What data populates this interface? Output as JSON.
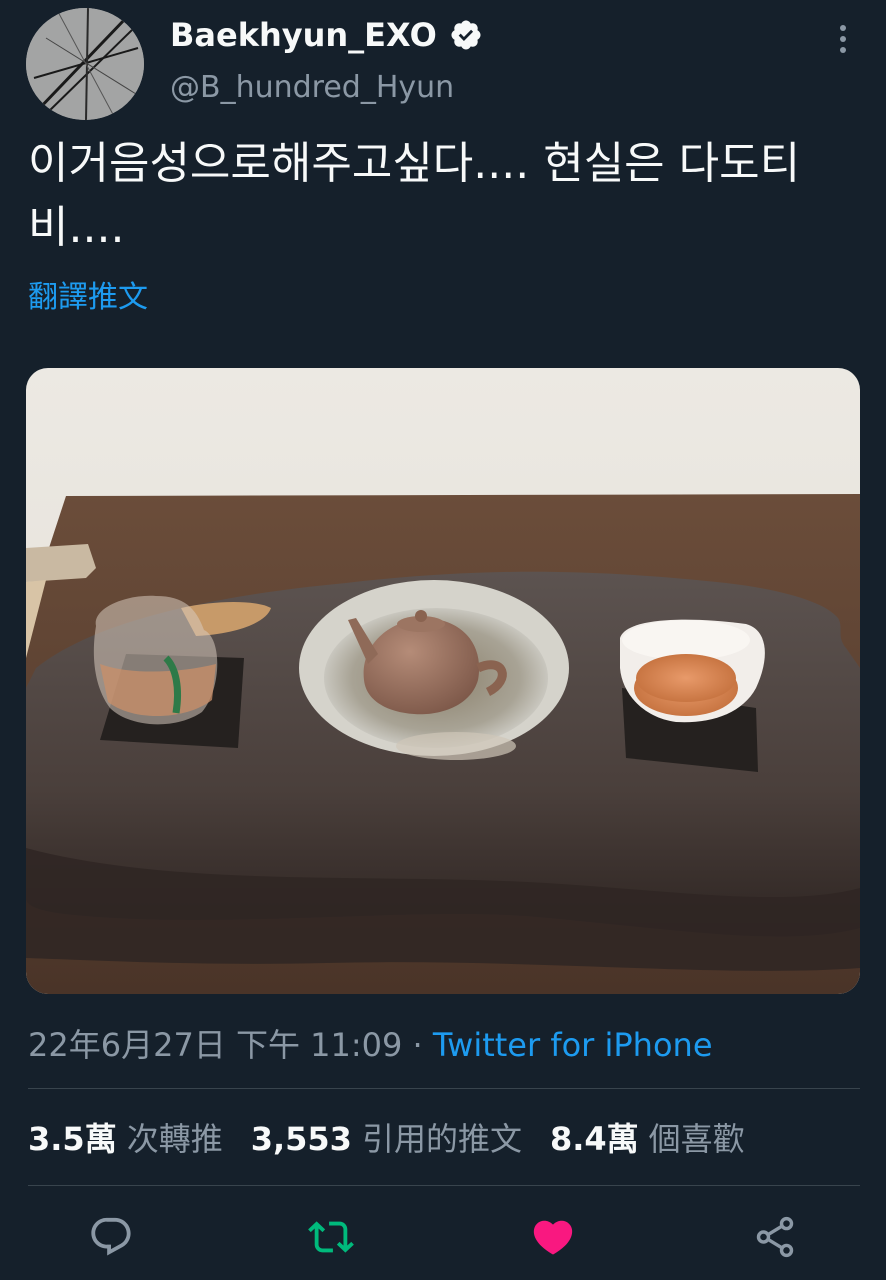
{
  "author": {
    "display_name": "Baekhyun_EXO",
    "handle": "@B_hundred_Hyun",
    "verified": true
  },
  "tweet": {
    "text": "이거음성으로해주고싶다.... 현실은 다도티비....",
    "translate_label": "翻譯推文",
    "date": "22年6月27日 下午 11:09",
    "separator": "·",
    "source": "Twitter for iPhone"
  },
  "stats": {
    "retweets_value": "3.5萬",
    "retweets_label": "次轉推",
    "quotes_value": "3,553",
    "quotes_label": "引用的推文",
    "likes_value": "8.4萬",
    "likes_label": "個喜歡"
  },
  "actions": [
    {
      "icon": "reply-icon"
    },
    {
      "icon": "retweet-icon",
      "color": "#00ba7c"
    },
    {
      "icon": "heart-icon",
      "color": "#f91880",
      "liked": true
    },
    {
      "icon": "share-icon"
    }
  ],
  "colors": {
    "background": "#15202b",
    "accent": "#1d9bf0",
    "muted": "#8b98a5"
  }
}
